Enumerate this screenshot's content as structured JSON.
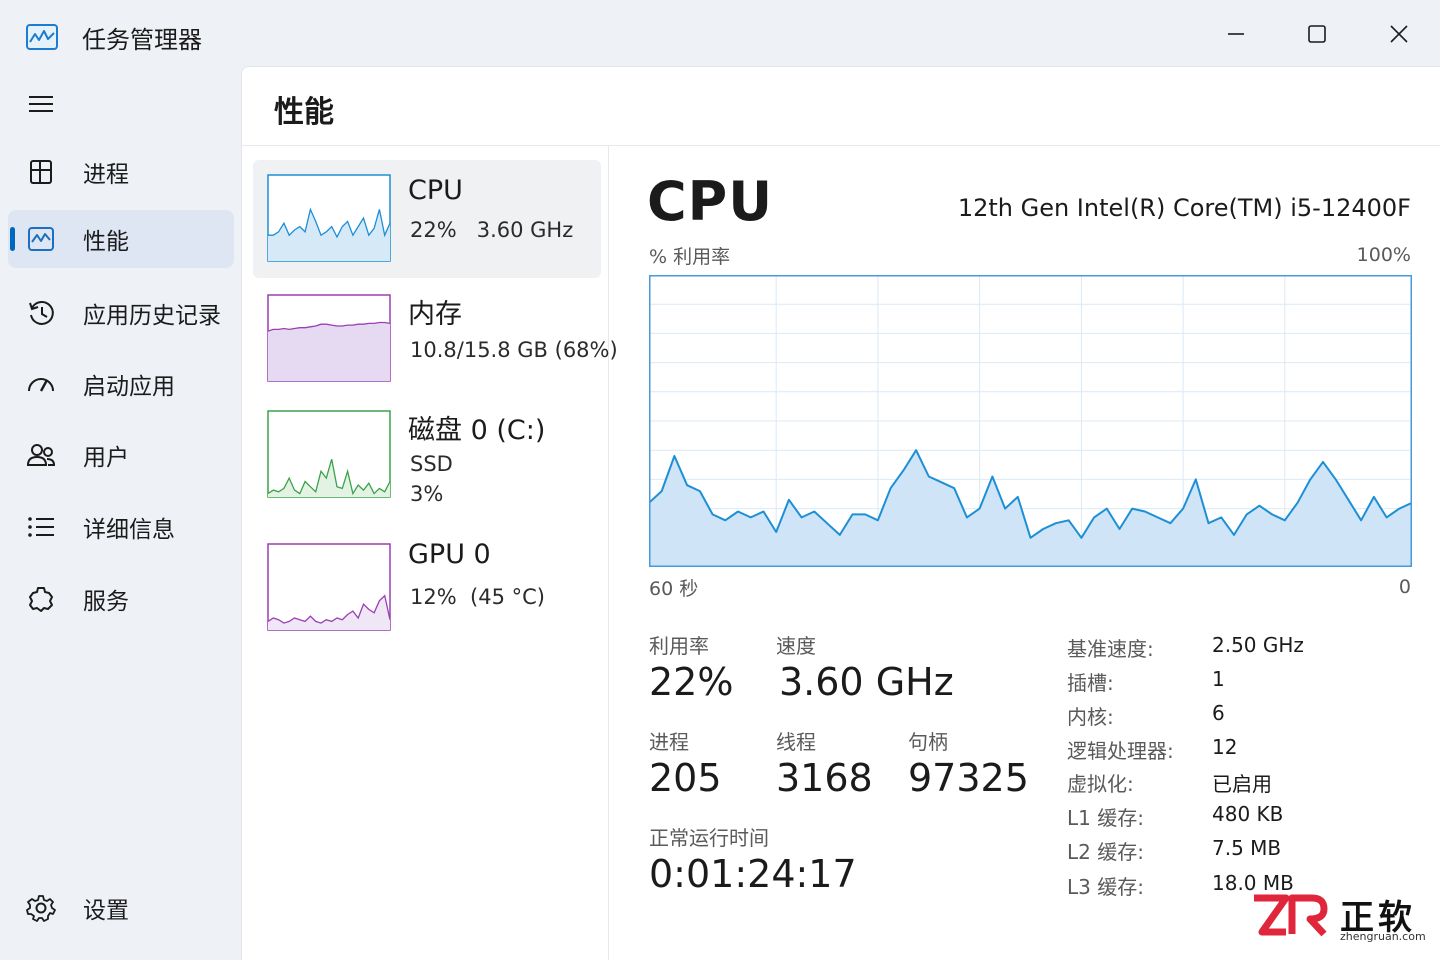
{
  "window": {
    "title": "任务管理器"
  },
  "nav": {
    "items": [
      {
        "label": "进程",
        "icon": "processes-icon"
      },
      {
        "label": "性能",
        "icon": "performance-icon",
        "active": true
      },
      {
        "label": "应用历史记录",
        "icon": "history-icon"
      },
      {
        "label": "启动应用",
        "icon": "startup-icon"
      },
      {
        "label": "用户",
        "icon": "users-icon"
      },
      {
        "label": "详细信息",
        "icon": "details-icon"
      },
      {
        "label": "服务",
        "icon": "services-icon"
      }
    ],
    "settings": {
      "label": "设置",
      "icon": "gear-icon"
    }
  },
  "page": {
    "title": "性能"
  },
  "resources": [
    {
      "name": "CPU",
      "sub": "22%   3.60 GHz",
      "color": "#1d8fd6",
      "fill": "#d6e9f7",
      "spark": [
        30,
        30,
        34,
        44,
        30,
        36,
        40,
        34,
        60,
        46,
        30,
        34,
        40,
        28,
        40,
        46,
        30,
        40,
        50,
        30,
        38,
        60,
        30,
        44
      ]
    },
    {
      "name": "内存",
      "sub": "10.8/15.8 GB (68%)",
      "color": "#9b3fb5",
      "fill": "#e6d9f2",
      "spark": [
        58,
        60,
        60,
        61,
        60,
        61,
        62,
        62,
        63,
        64,
        66,
        66,
        65,
        64,
        64,
        65,
        65,
        66,
        66,
        67,
        67,
        68,
        68,
        67
      ]
    },
    {
      "name": "磁盘 0 (C:)",
      "sub": "SSD",
      "sub2": "3%",
      "color": "#3aa24a",
      "fill": "#e3f3e3",
      "spark": [
        4,
        8,
        6,
        10,
        22,
        8,
        4,
        18,
        12,
        6,
        30,
        22,
        44,
        12,
        10,
        30,
        4,
        14,
        8,
        16,
        4,
        10,
        6,
        18
      ]
    },
    {
      "name": "GPU 0",
      "sub": "12%  (45 °C)",
      "color": "#9b3fb5",
      "fill": "#efe6f6",
      "spark": [
        10,
        14,
        12,
        8,
        10,
        14,
        12,
        10,
        16,
        10,
        8,
        12,
        10,
        14,
        12,
        18,
        22,
        14,
        30,
        24,
        20,
        34,
        40,
        12
      ]
    }
  ],
  "detail": {
    "title": "CPU",
    "model": "12th Gen Intel(R) Core(TM) i5-12400F",
    "util_label": "% 利用率",
    "util_max": "100%",
    "time_left": "60 秒",
    "time_right": "0",
    "stats": {
      "utilization": {
        "label": "利用率",
        "value": "22%"
      },
      "speed": {
        "label": "速度",
        "value": "3.60 GHz"
      },
      "processes": {
        "label": "进程",
        "value": "205"
      },
      "threads": {
        "label": "线程",
        "value": "3168"
      },
      "handles": {
        "label": "句柄",
        "value": "97325"
      },
      "uptime": {
        "label": "正常运行时间",
        "value": "0:01:24:17"
      }
    },
    "specs": [
      {
        "key": "基准速度:",
        "value": "2.50 GHz"
      },
      {
        "key": "插槽:",
        "value": "1"
      },
      {
        "key": "内核:",
        "value": "6"
      },
      {
        "key": "逻辑处理器:",
        "value": "12"
      },
      {
        "key": "虚拟化:",
        "value": "已启用"
      },
      {
        "key": "L1 缓存:",
        "value": "480 KB"
      },
      {
        "key": "L2 缓存:",
        "value": "7.5 MB"
      },
      {
        "key": "L3 缓存:",
        "value": "18.0 MB"
      }
    ]
  },
  "chart_data": {
    "type": "area",
    "title": "",
    "ylabel": "% 利用率",
    "ylim": [
      0,
      100
    ],
    "xlim": [
      60,
      0
    ],
    "grid": true,
    "color": "#1d8fd6",
    "fill": "#cfe4f6",
    "x": [
      60,
      59,
      58,
      57,
      56,
      55,
      54,
      53,
      52,
      51,
      50,
      49,
      48,
      47,
      46,
      45,
      44,
      43,
      42,
      41,
      40,
      39,
      38,
      37,
      36,
      35,
      34,
      33,
      32,
      31,
      30,
      29,
      28,
      27,
      26,
      25,
      24,
      23,
      22,
      21,
      20,
      19,
      18,
      17,
      16,
      15,
      14,
      13,
      12,
      11,
      10,
      9,
      8,
      7,
      6,
      5,
      4,
      3,
      2,
      1,
      0
    ],
    "values": [
      22,
      26,
      38,
      28,
      26,
      18,
      16,
      19,
      17,
      19,
      12,
      23,
      17,
      19,
      15,
      11,
      18,
      18,
      16,
      27,
      33,
      40,
      31,
      29,
      27,
      17,
      20,
      31,
      20,
      24,
      10,
      13,
      15,
      16,
      10,
      17,
      20,
      13,
      20,
      19,
      17,
      15,
      20,
      30,
      15,
      17,
      11,
      18,
      21,
      18,
      16,
      22,
      30,
      36,
      30,
      23,
      16,
      24,
      17,
      20,
      22
    ]
  },
  "watermark": {
    "cn": "正软",
    "en": "zhengruan.com",
    "brand_color": "#e0263b"
  }
}
